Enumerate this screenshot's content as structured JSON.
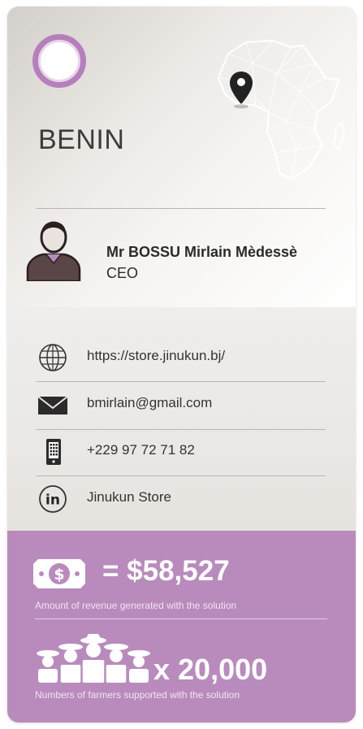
{
  "country": "BENIN",
  "person": {
    "name": "Mr BOSSU Mirlain Mèdessè",
    "role": "CEO"
  },
  "contacts": {
    "website": "https://store.jinukun.bj/",
    "email": "bmirlain@gmail.com",
    "phone": "+229 97 72 71 82",
    "linkedin": "Jinukun Store"
  },
  "stats": {
    "revenue_value": "= $58,527",
    "revenue_label": "Amount of revenue generated with the solution",
    "farmers_value": "x 20,000",
    "farmers_label": "Numbers of farmers supported with the solution"
  },
  "colors": {
    "accent": "#b98bbd",
    "ring": "#b57fbd",
    "text": "#2b2b2b"
  },
  "icons": [
    "africa-map-icon",
    "location-pin-icon",
    "person-icon",
    "globe-icon",
    "mail-icon",
    "phone-icon",
    "linkedin-icon",
    "money-icon",
    "farmers-icon"
  ]
}
